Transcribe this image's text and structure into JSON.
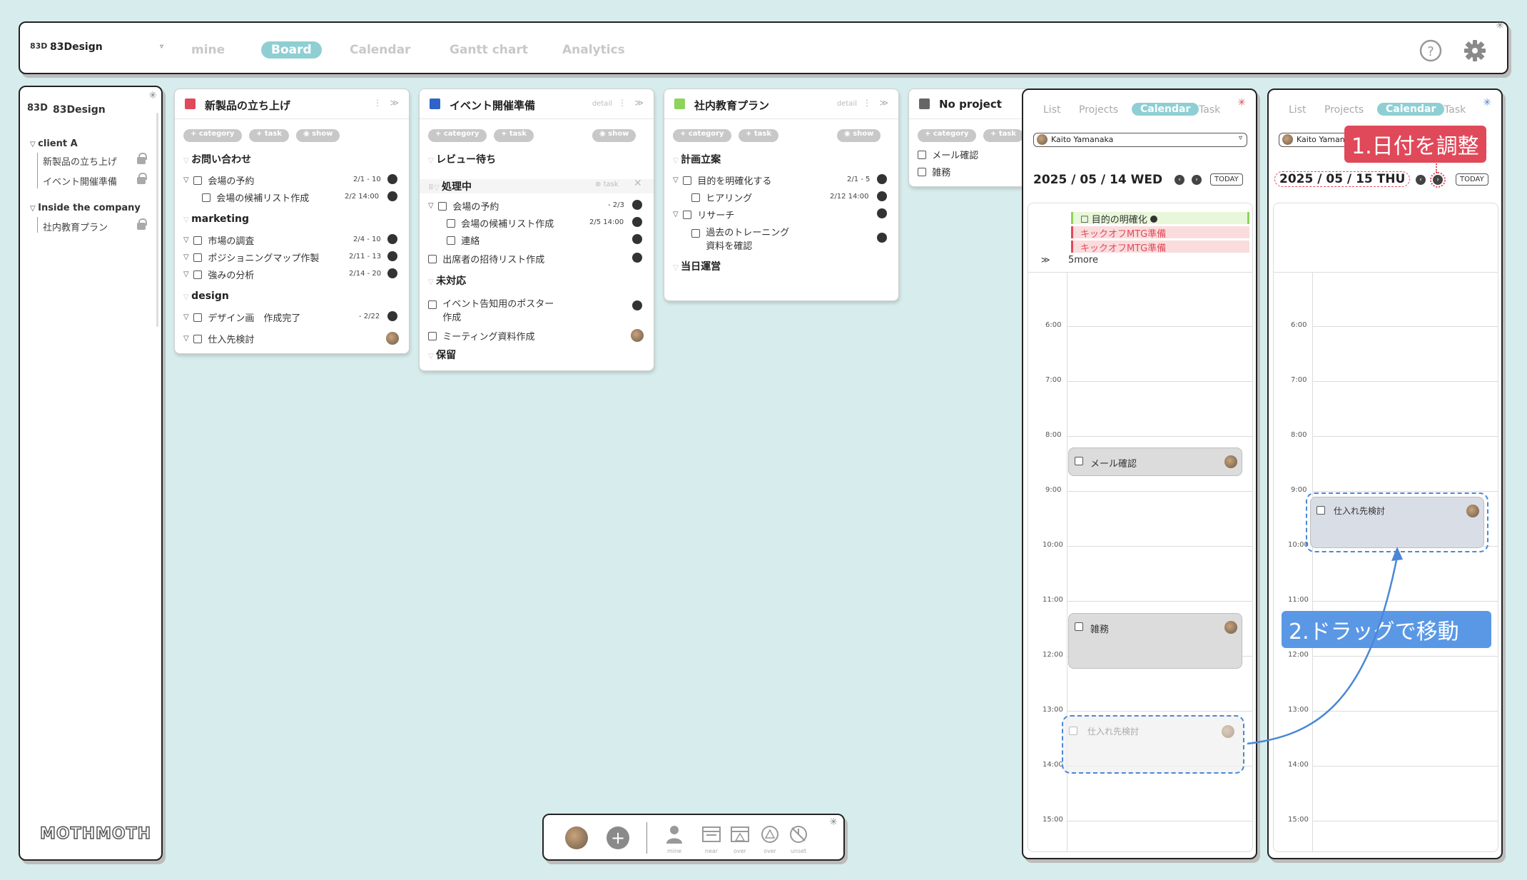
{
  "topbar": {
    "logo_mark": "83D",
    "workspace": "83Design",
    "nav": [
      "mine",
      "Board",
      "Calendar",
      "Gantt chart",
      "Analytics"
    ],
    "active_nav": "Board"
  },
  "sidebar": {
    "logo_mark": "83D",
    "workspace": "83Design",
    "groups": [
      {
        "name": "client A",
        "items": [
          "新製品の立ち上げ",
          "イベント開催準備"
        ]
      },
      {
        "name": "Inside the company",
        "items": [
          "社内教育プラン"
        ]
      }
    ],
    "footer_logo": "MOTHMOTH"
  },
  "buttons": {
    "category": "+ category",
    "task": "+ task",
    "show": "show",
    "detail": "detail",
    "add_task": "task"
  },
  "projects": [
    {
      "title": "新製品の立ち上げ",
      "color": "#e0495a",
      "cat1": "お問い合わせ",
      "t1": "会場の予約",
      "d1": "2/1 - 10",
      "t2": "会場の候補リスト作成",
      "d2": "2/2 14:00",
      "cat2": "marketing",
      "t3": "市場の調査",
      "d3": "2/4 - 10",
      "t4": "ポジショニングマップ作製",
      "d4": "2/11 - 13",
      "t5": "強みの分析",
      "d5": "2/14 - 20",
      "cat3": "design",
      "t6": "デザイン画　作成完了",
      "d6": "- 2/22",
      "t7": "仕入先検討"
    },
    {
      "title": "イベント開催準備",
      "color": "#2f63c9",
      "cat1": "レビュー待ち",
      "cat2": "処理中",
      "t1": "会場の予約",
      "d1": "- 2/3",
      "t2": "会場の候補リスト作成",
      "d2": "2/5 14:00",
      "t3": "連絡",
      "t4": "出席者の招待リスト作成",
      "cat3": "未対応",
      "t5": "イベント告知用のポスター",
      "t5b": "作成",
      "t6": "ミーティング資料作成",
      "cat4": "保留"
    },
    {
      "title": "社内教育プラン",
      "color": "#8ed35b",
      "cat1": "計画立案",
      "t1": "目的を明確化する",
      "d1": "2/1 - 5",
      "t2": "ヒアリング",
      "d2": "2/12 14:00",
      "t3": "リサーチ",
      "t4": "過去のトレーニング",
      "t4b": "資料を確認",
      "cat2": "当日運営"
    },
    {
      "title": "No project",
      "color": "#666666",
      "t1": "メール確認",
      "t2": "雑務"
    }
  ],
  "calendar_left": {
    "tabs": [
      "List",
      "Projects",
      "Calendar",
      "Task"
    ],
    "user": "Kaito Yamanaka",
    "date": "2025 / 05 / 14 WED",
    "today": "TODAY",
    "allday": [
      "目的の明確化",
      "キックオフMTG準備",
      "キックオフMTG準備"
    ],
    "more": "5more",
    "hours": [
      "6:00",
      "7:00",
      "8:00",
      "9:00",
      "10:00",
      "11:00",
      "12:00",
      "13:00",
      "14:00",
      "15:00"
    ],
    "events": [
      "メール確認",
      "雑務",
      "仕入れ先検討"
    ]
  },
  "calendar_right": {
    "tabs": [
      "List",
      "Projects",
      "Calendar",
      "Task"
    ],
    "user": "Kaito Yamana",
    "date": "2025 / 05 / 15 THU",
    "today": "TODAY",
    "hours": [
      "6:00",
      "7:00",
      "8:00",
      "9:00",
      "10:00",
      "11:00",
      "12:00",
      "13:00",
      "14:00",
      "15:00"
    ],
    "event": "仕入れ先検討"
  },
  "callouts": {
    "step1": "1.日付を調整",
    "step2": "2.ドラッグで移動"
  },
  "bottombar": {
    "labels": [
      "mine",
      "near",
      "over",
      "over",
      "unset"
    ]
  },
  "colors": {
    "accent": "#8fcfd3",
    "callout_red": "#e0495a",
    "callout_blue": "#5a98e6"
  }
}
